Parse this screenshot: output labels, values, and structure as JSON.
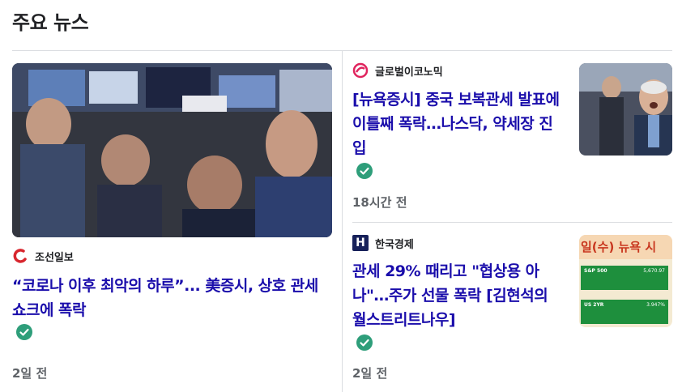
{
  "section": {
    "title": "주요 뉴스"
  },
  "articles": [
    {
      "source": "조선일보",
      "source_logo": "chosun-logo-icon",
      "headline": "“코로나 이후 최악의 하루”… 美증시, 상호 관세 쇼크에 폭락",
      "headline_lines": [
        "“코로나 이후 최악의 하루”... 美증시, 상호 관세",
        "쇼크에 폭락"
      ],
      "verified_icon": "verified-check-icon",
      "time": "2일 전",
      "thumbnail": "traders-on-floor-photo"
    },
    {
      "source": "글로벌이코노믹",
      "source_logo": "global-economic-logo-icon",
      "headline_lines": [
        "[뉴욕증시] 중국 보복관세 발표에",
        "이틀째 폭락…나스닥, 약세장 진",
        "입"
      ],
      "verified_icon": "verified-check-icon",
      "time": "18시간 전",
      "thumbnail": "shocked-trader-photo"
    },
    {
      "source": "한국경제",
      "source_logo": "hankyung-logo-icon",
      "source_logo_text": "H",
      "headline_lines": [
        "관세 29% 때리고 \"협상용 아",
        "나\"…주가 선물 폭락 [김현석의",
        "월스트리트나우]"
      ],
      "verified_icon": "verified-check-icon",
      "time": "2일 전",
      "thumbnail_text": "일(수) 뉴욕 시",
      "thumbnail_rows": [
        {
          "name": "S&P 500",
          "value": "5,670.97"
        },
        {
          "name": "US 2YR",
          "value": "3.947%"
        }
      ]
    }
  ],
  "colors": {
    "headline": "#1a0dab",
    "verified": "#34a853",
    "meta": "#5f6368"
  }
}
